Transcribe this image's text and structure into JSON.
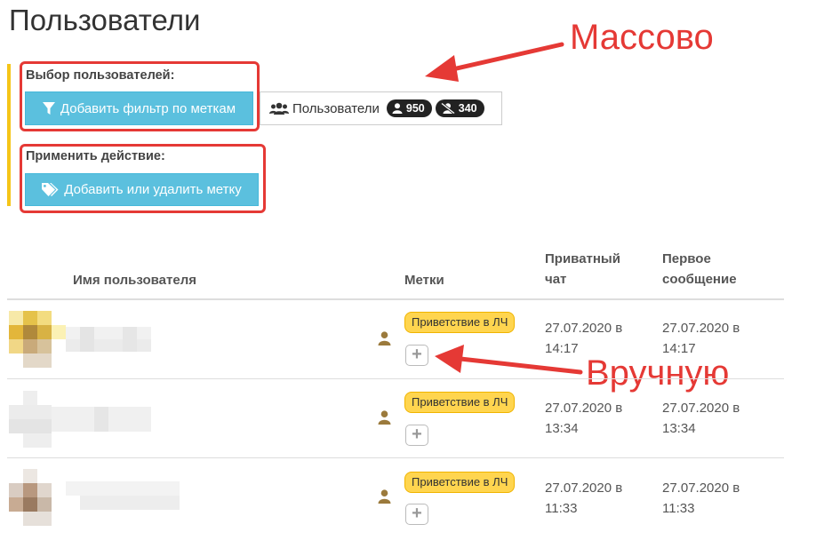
{
  "page": {
    "title": "Пользователи"
  },
  "selection": {
    "label": "Выбор пользователей:",
    "filter_button": "Добавить фильтр по меткам",
    "users_label": "Пользователи",
    "count_active": "950",
    "count_blocked": "340"
  },
  "action": {
    "label": "Применить действие:",
    "tag_button": "Добавить или удалить метку"
  },
  "annotations": {
    "bulk": "Массово",
    "manual": "Вручную",
    "color": "#e53935"
  },
  "table": {
    "headers": {
      "name": "Имя пользователя",
      "tags": "Метки",
      "private_chat": "Приватный чат",
      "first_message": "Первое сообщение"
    },
    "rows": [
      {
        "tag": "Приветствие в ЛЧ",
        "private_date": "27.07.2020 в",
        "private_time": "14:17",
        "first_date": "27.07.2020 в",
        "first_time": "14:17"
      },
      {
        "tag": "Приветствие в ЛЧ",
        "private_date": "27.07.2020 в",
        "private_time": "13:34",
        "first_date": "27.07.2020 в",
        "first_time": "13:34"
      },
      {
        "tag": "Приветствие в ЛЧ",
        "private_date": "27.07.2020 в",
        "private_time": "11:33",
        "first_date": "27.07.2020 в",
        "first_time": "11:33"
      }
    ]
  },
  "colors": {
    "accent_button": "#5bc0de",
    "tag_bg": "#ffd54f",
    "left_bar": "#f5c518"
  },
  "icons": [
    "filter-icon",
    "tag-icon",
    "users-icon",
    "user-icon",
    "user-slash-icon",
    "plus-icon"
  ]
}
